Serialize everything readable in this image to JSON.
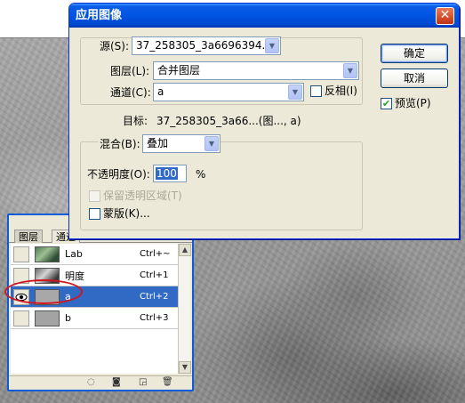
{
  "dialog": {
    "title": "应用图像",
    "close_glyph": "✕",
    "source_label": "源(S):",
    "source_value": "37_258305_3a6696394...",
    "layer_label": "图层(L):",
    "layer_value": "合并图层",
    "channel_label": "通道(C):",
    "channel_value": "a",
    "invert_label": "反相(I)",
    "invert_checked": false,
    "target_label": "目标:",
    "target_value": "37_258305_3a66...(图..., a)",
    "blending_label": "混合(B):",
    "blending_value": "叠加",
    "opacity_label": "不透明度(O):",
    "opacity_value": "100",
    "opacity_unit": "%",
    "preserve_transparency_label": "保留透明区域(T)",
    "preserve_transparency_enabled": false,
    "mask_label": "蒙版(K)...",
    "mask_checked": false,
    "ok_label": "确定",
    "cancel_label": "取消",
    "preview_label": "预览(P)",
    "preview_checked": true
  },
  "palette": {
    "tabs": [
      "图层",
      "通道"
    ],
    "active_tab": "通道",
    "channels": [
      {
        "name": "Lab",
        "shortcut": "Ctrl+~",
        "visible": false,
        "selected": false
      },
      {
        "name": "明度",
        "shortcut": "Ctrl+1",
        "visible": false,
        "selected": false
      },
      {
        "name": "a",
        "shortcut": "Ctrl+2",
        "visible": true,
        "selected": true
      },
      {
        "name": "b",
        "shortcut": "Ctrl+3",
        "visible": false,
        "selected": false
      }
    ]
  },
  "colors": {
    "titlebar": "#0054e3",
    "selection": "#316ac5",
    "highlight_ellipse": "#d2141e",
    "dialog_bg": "#ece9d8"
  }
}
